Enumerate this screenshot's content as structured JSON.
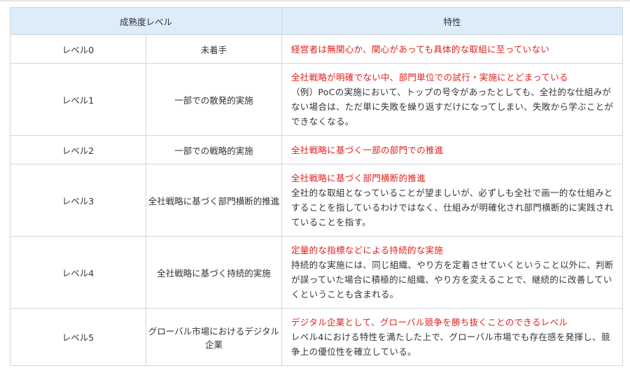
{
  "table": {
    "headers": {
      "maturity": "成熟度レベル",
      "trait": "特性"
    },
    "rows": [
      {
        "level": "レベル0",
        "maturity": "未着手",
        "headline": "経営者は無関心か、関心があっても具体的な取組に至っていない",
        "description": ""
      },
      {
        "level": "レベル1",
        "maturity": "一部での散発的実施",
        "headline": "全社戦略が明確でない中、部門単位での試行・実施にとどまっている",
        "description": "（例）PoCの実施において、トップの号令があったとしても、全社的な仕組みがない場合は、ただ単に失敗を繰り返すだけになってしまい、失敗から学ぶことができなくなる。"
      },
      {
        "level": "レベル2",
        "maturity": "一部での戦略的実施",
        "headline": "全社戦略に基づく一部の部門での推進",
        "description": ""
      },
      {
        "level": "レベル3",
        "maturity": "全社戦略に基づく部門横断的推進",
        "headline": "全社戦略に基づく部門横断的推進",
        "description": "全社的な取組となっていることが望ましいが、必ずしも全社で画一的な仕組みとすることを指しているわけではなく、仕組みが明確化され部門横断的に実践されていることを指す。"
      },
      {
        "level": "レベル4",
        "maturity": "全社戦略に基づく持続的実施",
        "headline": "定量的な指標などによる持続的な実施",
        "description": "持続的な実施には、同じ組織、やり方を定着させていくということ以外に、判断が誤っていた場合に積極的に組織、やり方を変えることで、継続的に改善していくということも含まれる。"
      },
      {
        "level": "レベル5",
        "maturity": "グローバル市場におけるデジタル企業",
        "headline": "デジタル企業として、グローバル競争を勝ち抜くことのできるレベル",
        "description": "レベル4における特性を満たした上で、グローバル市場でも存在感を発揮し、競争上の優位性を確立している。"
      }
    ]
  },
  "colors": {
    "header_bg": "#dcecf8",
    "border": "#cfd6dc",
    "highlight": "#e31e1e",
    "text": "#333333"
  }
}
